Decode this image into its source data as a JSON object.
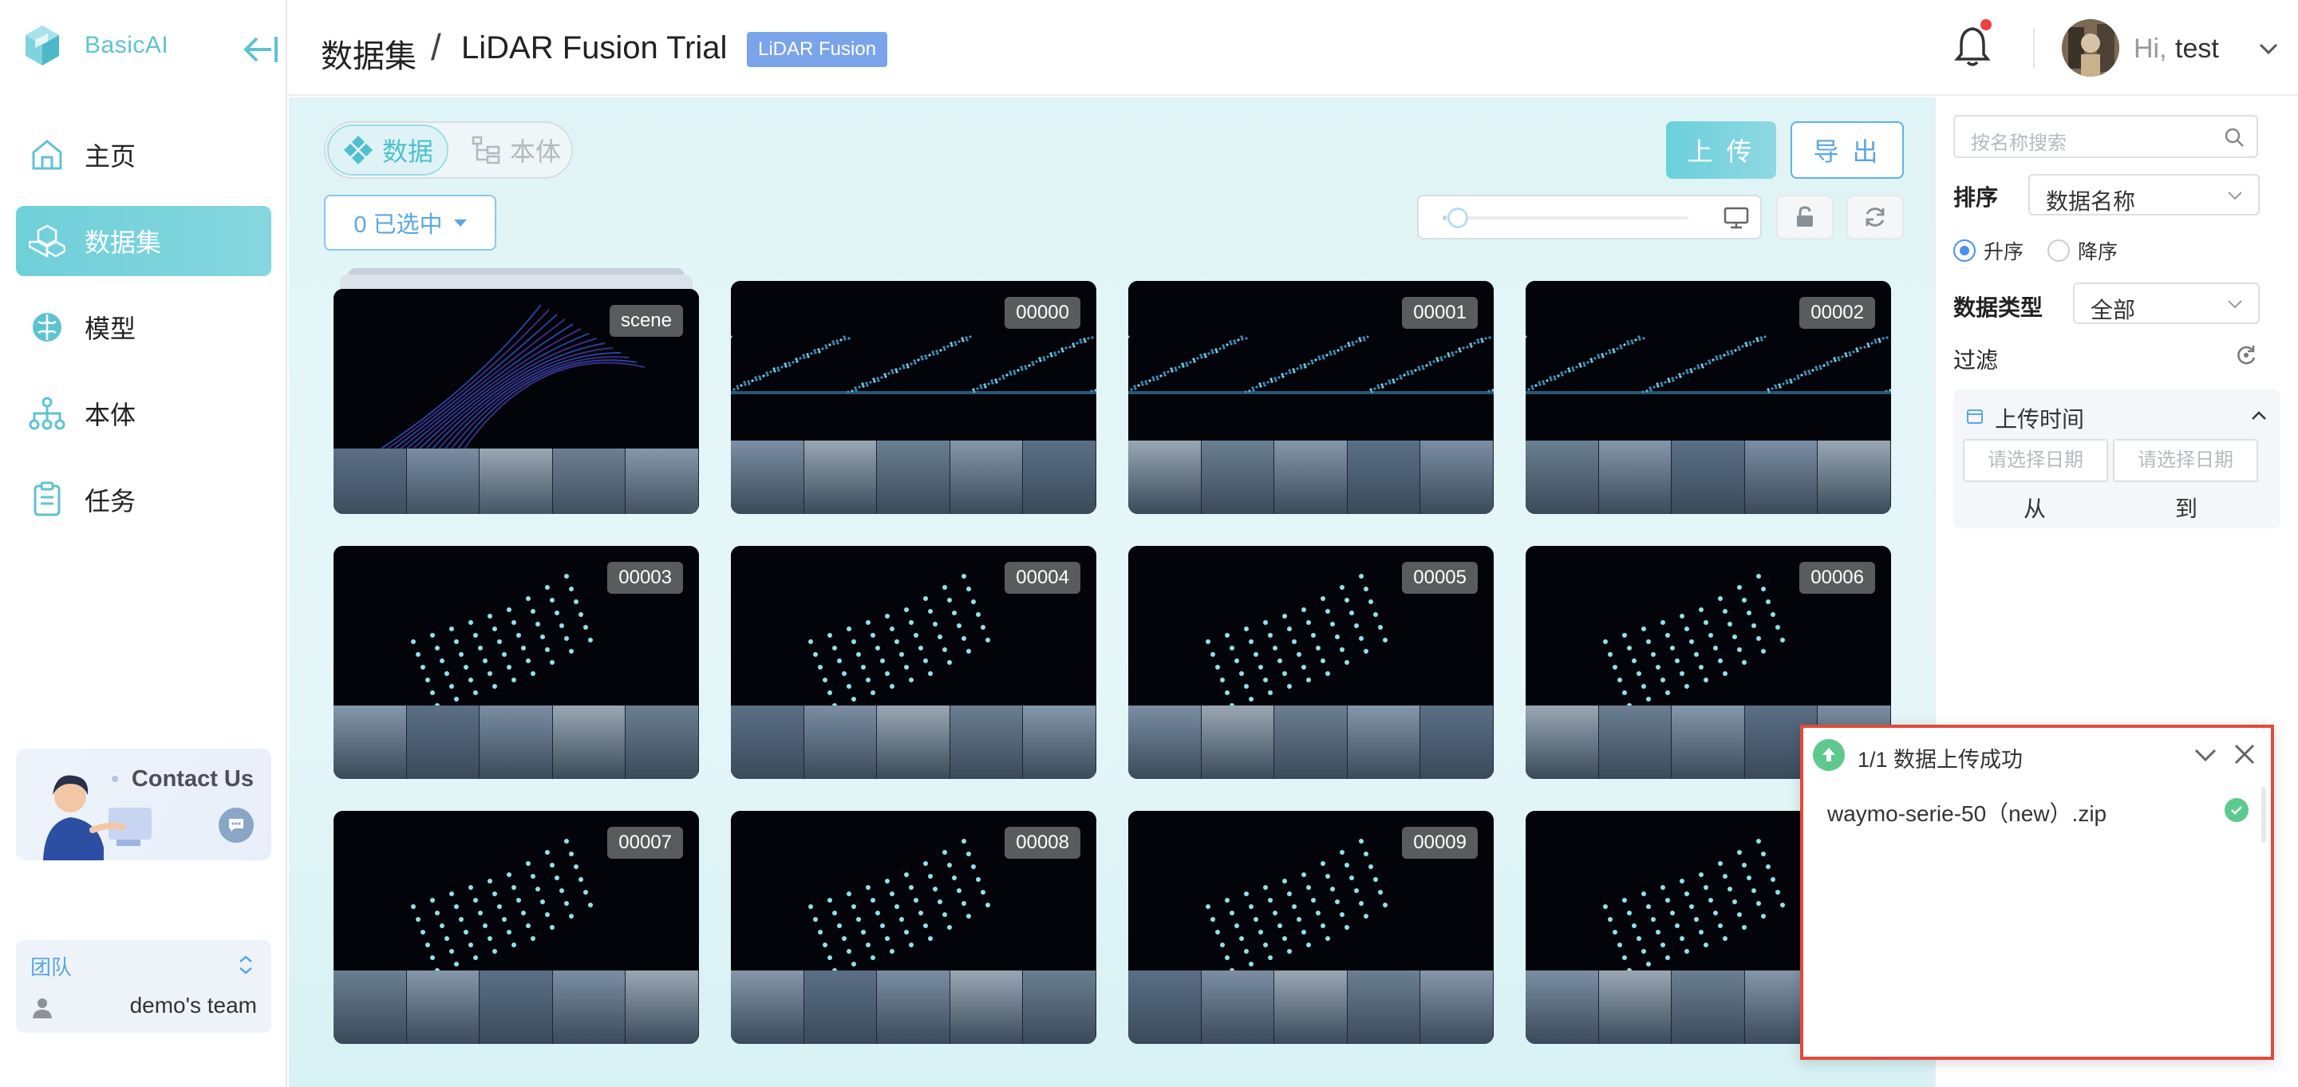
{
  "brand": {
    "name": "BasicAI"
  },
  "nav": [
    {
      "label": "主页",
      "icon": "home-icon"
    },
    {
      "label": "数据集",
      "icon": "dataset-cubes-icon",
      "active": true
    },
    {
      "label": "模型",
      "icon": "brain-icon"
    },
    {
      "label": "本体",
      "icon": "hierarchy-icon"
    },
    {
      "label": "任务",
      "icon": "clipboard-icon"
    }
  ],
  "contact": {
    "label": "Contact Us"
  },
  "team": {
    "label": "团队",
    "name": "demo's team"
  },
  "header": {
    "breadcrumb_root": "数据集",
    "separator": "/",
    "dataset_name": "LiDAR Fusion Trial",
    "dataset_type_tag": "LiDAR Fusion",
    "greeting": "Hi,",
    "user": "test"
  },
  "toolbar": {
    "tab_data": "数据",
    "tab_ontology": "本体",
    "upload": "上 传",
    "export": "导 出",
    "selected": "0 已选中"
  },
  "zoom": {
    "level": 0.0
  },
  "grid": {
    "items": [
      {
        "label": "scene",
        "kind": "scene"
      },
      {
        "label": "00000",
        "kind": "frame"
      },
      {
        "label": "00001",
        "kind": "frame"
      },
      {
        "label": "00002",
        "kind": "frame"
      },
      {
        "label": "00003",
        "kind": "frame"
      },
      {
        "label": "00004",
        "kind": "frame"
      },
      {
        "label": "00005",
        "kind": "frame"
      },
      {
        "label": "00006",
        "kind": "frame"
      },
      {
        "label": "00007",
        "kind": "frame"
      },
      {
        "label": "00008",
        "kind": "frame"
      },
      {
        "label": "00009",
        "kind": "frame"
      },
      {
        "label": "",
        "kind": "frame"
      }
    ]
  },
  "filters": {
    "search_placeholder": "按名称搜索",
    "sort_label": "排序",
    "sort_value": "数据名称",
    "asc": "升序",
    "desc": "降序",
    "type_label": "数据类型",
    "type_value": "全部",
    "filter_label": "过滤",
    "upload_time": "上传时间",
    "date_placeholder": "请选择日期",
    "from": "从",
    "to": "到"
  },
  "notification": {
    "title": "1/1 数据上传成功",
    "file": "waymo-serie-50（new）.zip"
  },
  "colors": {
    "accent": "#6fd0da",
    "blue": "#5aa7e3",
    "success": "#5ec98d",
    "highlight_border": "#e14b3b"
  }
}
